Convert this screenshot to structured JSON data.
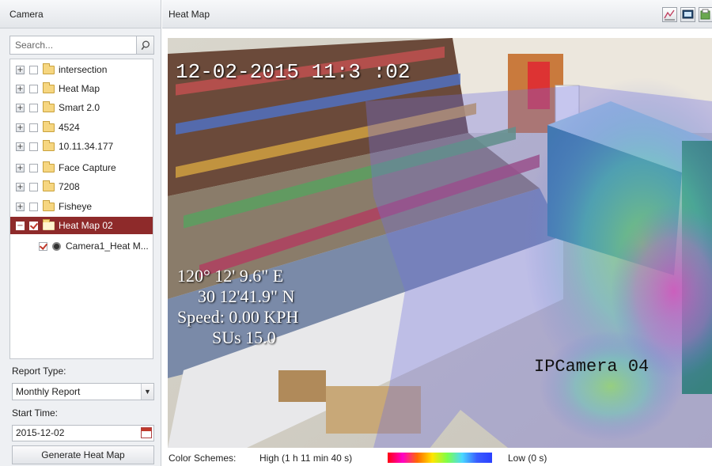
{
  "left_panel": {
    "title": "Camera",
    "search": {
      "placeholder": "Search...",
      "value": ""
    },
    "tree": [
      {
        "label": "intersection",
        "expander": "+",
        "checked": false
      },
      {
        "label": "Heat Map",
        "expander": "+",
        "checked": false
      },
      {
        "label": "Smart 2.0",
        "expander": "+",
        "checked": false
      },
      {
        "label": "4524",
        "expander": "+",
        "checked": false
      },
      {
        "label": "10.11.34.177",
        "expander": "+",
        "checked": false
      },
      {
        "label": "Face Capture",
        "expander": "+",
        "checked": false
      },
      {
        "label": "7208",
        "expander": "+",
        "checked": false
      },
      {
        "label": "Fisheye",
        "expander": "+",
        "checked": false
      },
      {
        "label": "Heat Map 02",
        "expander": "−",
        "checked": true,
        "selected": true
      },
      {
        "label": "Camera1_Heat M...",
        "checked": true,
        "child": true
      }
    ],
    "report_type_label": "Report Type:",
    "report_type_value": "Monthly Report",
    "start_time_label": "Start Time:",
    "start_time_value": "2015-12-02",
    "generate_button": "Generate Heat Map"
  },
  "right_panel": {
    "title": "Heat Map",
    "toolbar_icons": [
      "heat-chart-icon",
      "display-icon",
      "export-icon"
    ],
    "video": {
      "timestamp": "12-02-2015 11:3 :02",
      "osd_lines": [
        "120° 12' 9.6\" E",
        "30 12'41.9\" N",
        "Speed: 0.00 KPH",
        "SUs 15.0"
      ],
      "camera_name": "IPCamera 04"
    },
    "legend": {
      "label": "Color Schemes:",
      "high": "High (1 h 11 min 40 s)",
      "low": "Low (0 s)"
    }
  }
}
